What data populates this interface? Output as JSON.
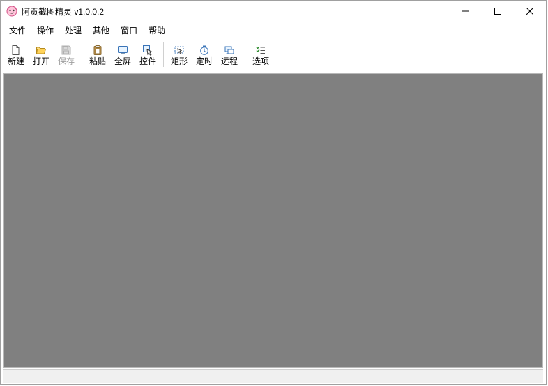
{
  "window": {
    "title": "阿贡截图精灵 v1.0.0.2"
  },
  "menu": {
    "items": [
      "文件",
      "操作",
      "处理",
      "其他",
      "窗口",
      "帮助"
    ]
  },
  "toolbar": {
    "groups": [
      [
        {
          "name": "new",
          "label": "新建",
          "icon": "new-file-icon",
          "enabled": true
        },
        {
          "name": "open",
          "label": "打开",
          "icon": "folder-open-icon",
          "enabled": true
        },
        {
          "name": "save",
          "label": "保存",
          "icon": "floppy-disk-icon",
          "enabled": false
        }
      ],
      [
        {
          "name": "paste",
          "label": "粘贴",
          "icon": "clipboard-icon",
          "enabled": true
        },
        {
          "name": "fullscreen",
          "label": "全屏",
          "icon": "screen-icon",
          "enabled": true
        },
        {
          "name": "control",
          "label": "控件",
          "icon": "pointer-box-icon",
          "enabled": true
        }
      ],
      [
        {
          "name": "rect",
          "label": "矩形",
          "icon": "rect-select-icon",
          "enabled": true
        },
        {
          "name": "timer",
          "label": "定时",
          "icon": "timer-icon",
          "enabled": true
        },
        {
          "name": "remote",
          "label": "远程",
          "icon": "remote-icon",
          "enabled": true
        }
      ],
      [
        {
          "name": "options",
          "label": "选项",
          "icon": "check-list-icon",
          "enabled": true
        }
      ]
    ]
  }
}
